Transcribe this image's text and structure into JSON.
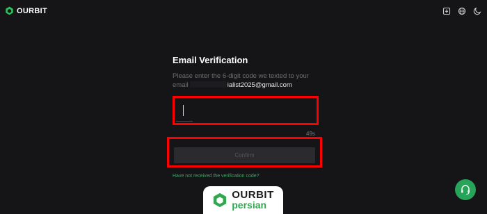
{
  "header": {
    "brand": "OURBIT",
    "icons": [
      "download-icon",
      "globe-icon",
      "moon-icon"
    ]
  },
  "form": {
    "title": "Email Verification",
    "description": "Please enter the 6-digit code we texted to your",
    "email_prefix": "email",
    "email_visible_part": "ialist2025@gmail.com",
    "code_value": "",
    "countdown": "49s",
    "confirm_label": "Confirm",
    "resend_link": "Have not received the verification code?"
  },
  "watermark": {
    "brand": "OURBIT",
    "subtitle": "persian"
  },
  "support": {
    "icon": "headset-icon"
  },
  "colors": {
    "background": "#151518",
    "accent_green": "#27a35a",
    "highlight_red": "#ff0000",
    "button_bg": "#2b2b2f"
  }
}
